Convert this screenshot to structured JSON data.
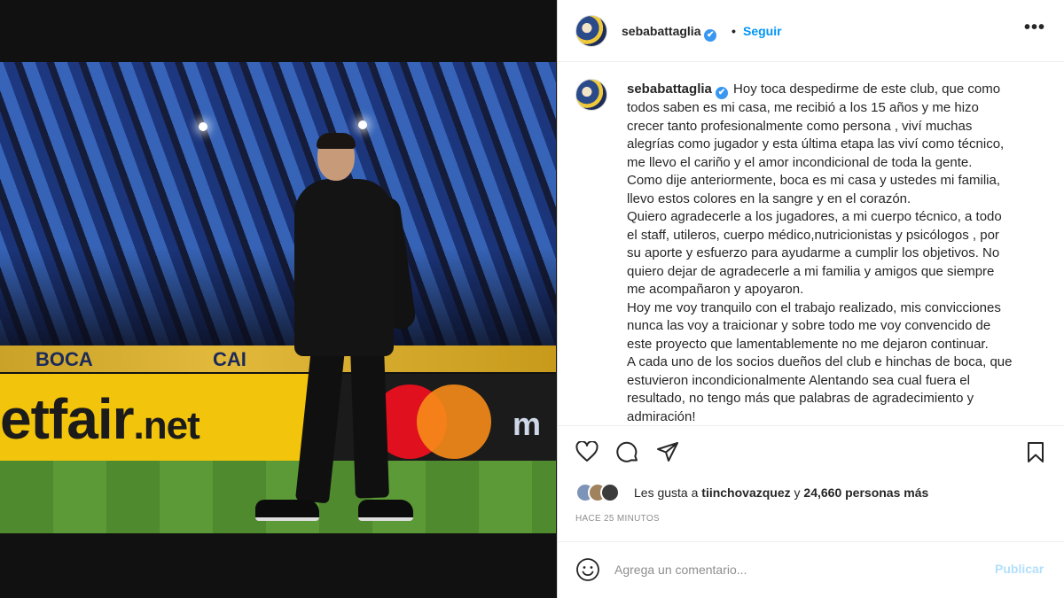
{
  "post": {
    "username": "sebabattaglia",
    "verified_mark": "✔",
    "separator": "•",
    "follow_label": "Seguir",
    "more_label": "•••",
    "caption_lines": [
      "Hoy toca despedirme de este club, que como",
      "todos saben es mi casa, me recibió a los 15 años y me hizo",
      "crecer tanto profesionalmente como persona , viví muchas",
      "alegrías como jugador y esta última etapa las viví como técnico,",
      "me llevo el cariño y el amor incondicional de toda la gente.",
      "Como dije anteriormente, boca es mi casa y ustedes mi familia,",
      "llevo estos colores en la sangre y en el corazón.",
      "Quiero agradecerle a los jugadores, a mi cuerpo técnico, a todo",
      "el staff, utileros, cuerpo médico,nutricionistas y psicólogos , por",
      "su aporte y esfuerzo para ayudarme a cumplir los objetivos. No",
      "quiero dejar de agradecerle a mi familia y amigos que siempre",
      "me acompañaron y apoyaron.",
      "Hoy me voy tranquilo con el trabajo realizado, mis convicciones",
      "nunca las voy a traicionar y sobre todo me voy convencido de",
      "este proyecto que lamentablemente no me dejaron continuar.",
      "A cada uno de los socios dueños del club e hinchas de boca, que",
      "estuvieron incondicionalmente Alentando sea cual fuera el",
      "resultado, no tengo más que palabras de agradecimiento y",
      "admiración!"
    ],
    "likes": {
      "prefix": "Les gusta a",
      "user": "tiinchovazquez",
      "connector": "y",
      "count_text": "24,660 personas más"
    },
    "timestamp": "HACE 25 MINUTOS",
    "comment_placeholder": "Agrega un comentario...",
    "publish_label": "Publicar"
  },
  "photo": {
    "board_text_main": "etfair",
    "board_text_suffix": ".net",
    "banner_text_left": "BOCA",
    "banner_text_right": "CAI",
    "sponsor_text": "m"
  },
  "icons": {
    "emoji": "smiley-icon",
    "like": "heart-icon",
    "comment": "comment-icon",
    "share": "share-icon",
    "save": "bookmark-icon"
  },
  "colors": {
    "accent": "#0095f6",
    "publish_disabled": "#b2dffc",
    "verified": "#3897f0",
    "text": "#262626",
    "muted": "#8e8e8e"
  }
}
